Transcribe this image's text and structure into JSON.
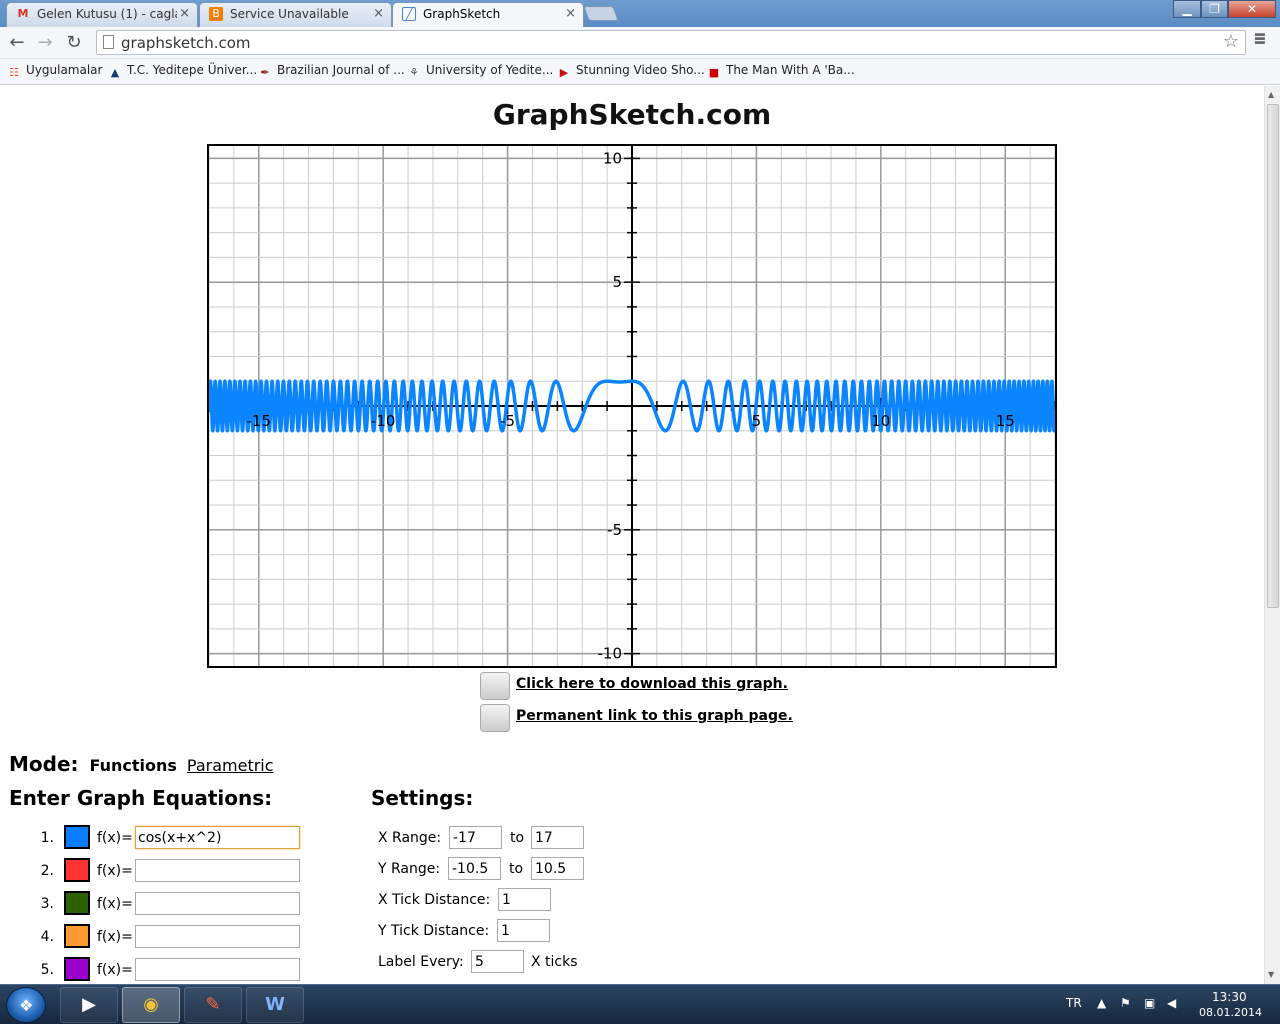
{
  "browser": {
    "tabs": [
      {
        "label": "Gelen Kutusu (1) - caglaal",
        "icon": "gmail-icon",
        "icon_char": "M",
        "icon_color": "#d93025"
      },
      {
        "label": "Service Unavailable",
        "icon": "blogger-icon",
        "icon_char": "B",
        "icon_color": "#f57d00"
      },
      {
        "label": "GraphSketch",
        "icon": "graphsketch-icon",
        "icon_char": "╱",
        "icon_color": "#4a86c5"
      }
    ],
    "url": "graphsketch.com",
    "bookmarks": [
      {
        "label": "Uygulamalar",
        "icon": "apps-grid-icon",
        "icon_char": "☷",
        "icon_color": "#e04b2a"
      },
      {
        "label": "T.C. Yeditepe Üniver...",
        "icon": "yeditepe-icon",
        "icon_char": "▲",
        "icon_color": "#1b3b6f"
      },
      {
        "label": "Brazilian Journal of ...",
        "icon": "journal-icon",
        "icon_char": "✒",
        "icon_color": "#8b1a1a"
      },
      {
        "label": "University of Yedite...",
        "icon": "university-icon",
        "icon_char": "⚘",
        "icon_color": "#555555"
      },
      {
        "label": "Stunning Video Sho...",
        "icon": "video-icon",
        "icon_char": "▶",
        "icon_color": "#cc1111"
      },
      {
        "label": "The Man With A 'Ba...",
        "icon": "cnn-icon",
        "icon_char": "■",
        "icon_color": "#cc0000"
      }
    ]
  },
  "site": {
    "title": "GraphSketch.com",
    "download_link": "Click here to download this graph.",
    "permalink": "Permanent link to this graph page.",
    "mode_label": "Mode:",
    "mode_active": "Functions",
    "mode_other": "Parametric",
    "equations_heading": "Enter Graph Equations:",
    "settings_heading": "Settings:",
    "fx_label": "f(x)=",
    "equations": [
      {
        "num": "1.",
        "color": "#0a7cff",
        "value": "cos(x+x^2)"
      },
      {
        "num": "2.",
        "color": "#ff3333",
        "value": ""
      },
      {
        "num": "3.",
        "color": "#2e5f00",
        "value": ""
      },
      {
        "num": "4.",
        "color": "#ff9933",
        "value": ""
      },
      {
        "num": "5.",
        "color": "#9900cc",
        "value": ""
      }
    ],
    "settings": {
      "x_range_label": "X Range:",
      "x_min": "-17",
      "x_max": "17",
      "y_range_label": "Y Range:",
      "y_min": "-10.5",
      "y_max": "10.5",
      "to_label": "to",
      "x_tick_label": "X Tick Distance:",
      "x_tick": "1",
      "y_tick_label": "Y Tick Distance:",
      "y_tick": "1",
      "label_every_label": "Label Every:",
      "label_every": "5",
      "x_ticks_suffix": "X ticks"
    }
  },
  "chart_data": {
    "type": "line",
    "function": "cos(x+x^2)",
    "xlim": [
      -17,
      17
    ],
    "ylim": [
      -10.5,
      10.5
    ],
    "x_tick": 1,
    "y_tick": 1,
    "label_every": 5,
    "x_tick_labels": [
      "-15",
      "-10",
      "-5",
      "5",
      "10",
      "15"
    ],
    "y_tick_labels": [
      "10",
      "5",
      "-5",
      "-10"
    ],
    "grid": true,
    "series": [
      {
        "color": "#0a84ff"
      }
    ]
  },
  "taskbar": {
    "language": "TR",
    "time": "13:30",
    "date": "08.01.2014"
  }
}
